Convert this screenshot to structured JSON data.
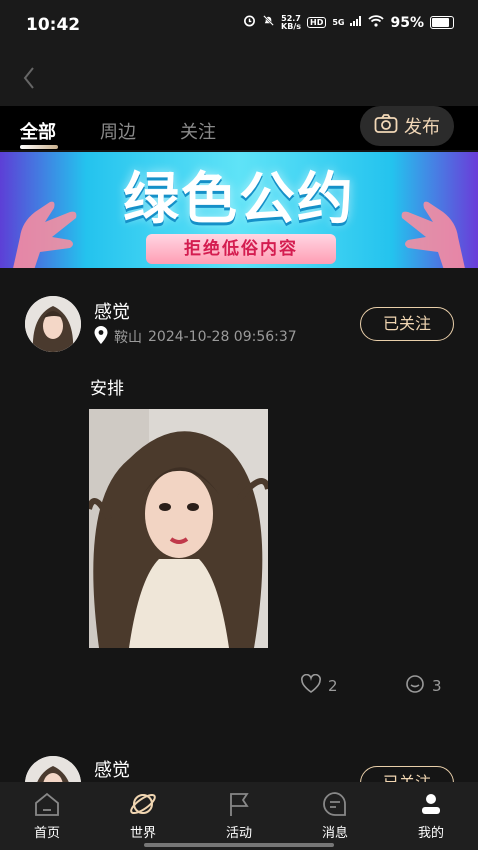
{
  "status_bar": {
    "time": "10:42",
    "net_speed_value": "52.7",
    "net_speed_unit": "KB/s",
    "hd": "HD",
    "network": "5G",
    "battery": "95%"
  },
  "tabs": {
    "all": "全部",
    "nearby": "周边",
    "follow": "关注",
    "publish": "发布"
  },
  "banner": {
    "title": "绿色公约",
    "subtitle": "拒绝低俗内容"
  },
  "posts": [
    {
      "username": "感觉",
      "location": "鞍山",
      "timestamp": "2024-10-28 09:56:37",
      "follow_label": "已关注",
      "text": "安排",
      "likes": "2",
      "comments": "3"
    },
    {
      "username": "感觉",
      "follow_label": "已关注"
    }
  ],
  "tabbar": {
    "home": "首页",
    "world": "世界",
    "activity": "活动",
    "messages": "消息",
    "mine": "我的"
  },
  "colors": {
    "accent": "#f0d5b1",
    "background": "#151515"
  }
}
